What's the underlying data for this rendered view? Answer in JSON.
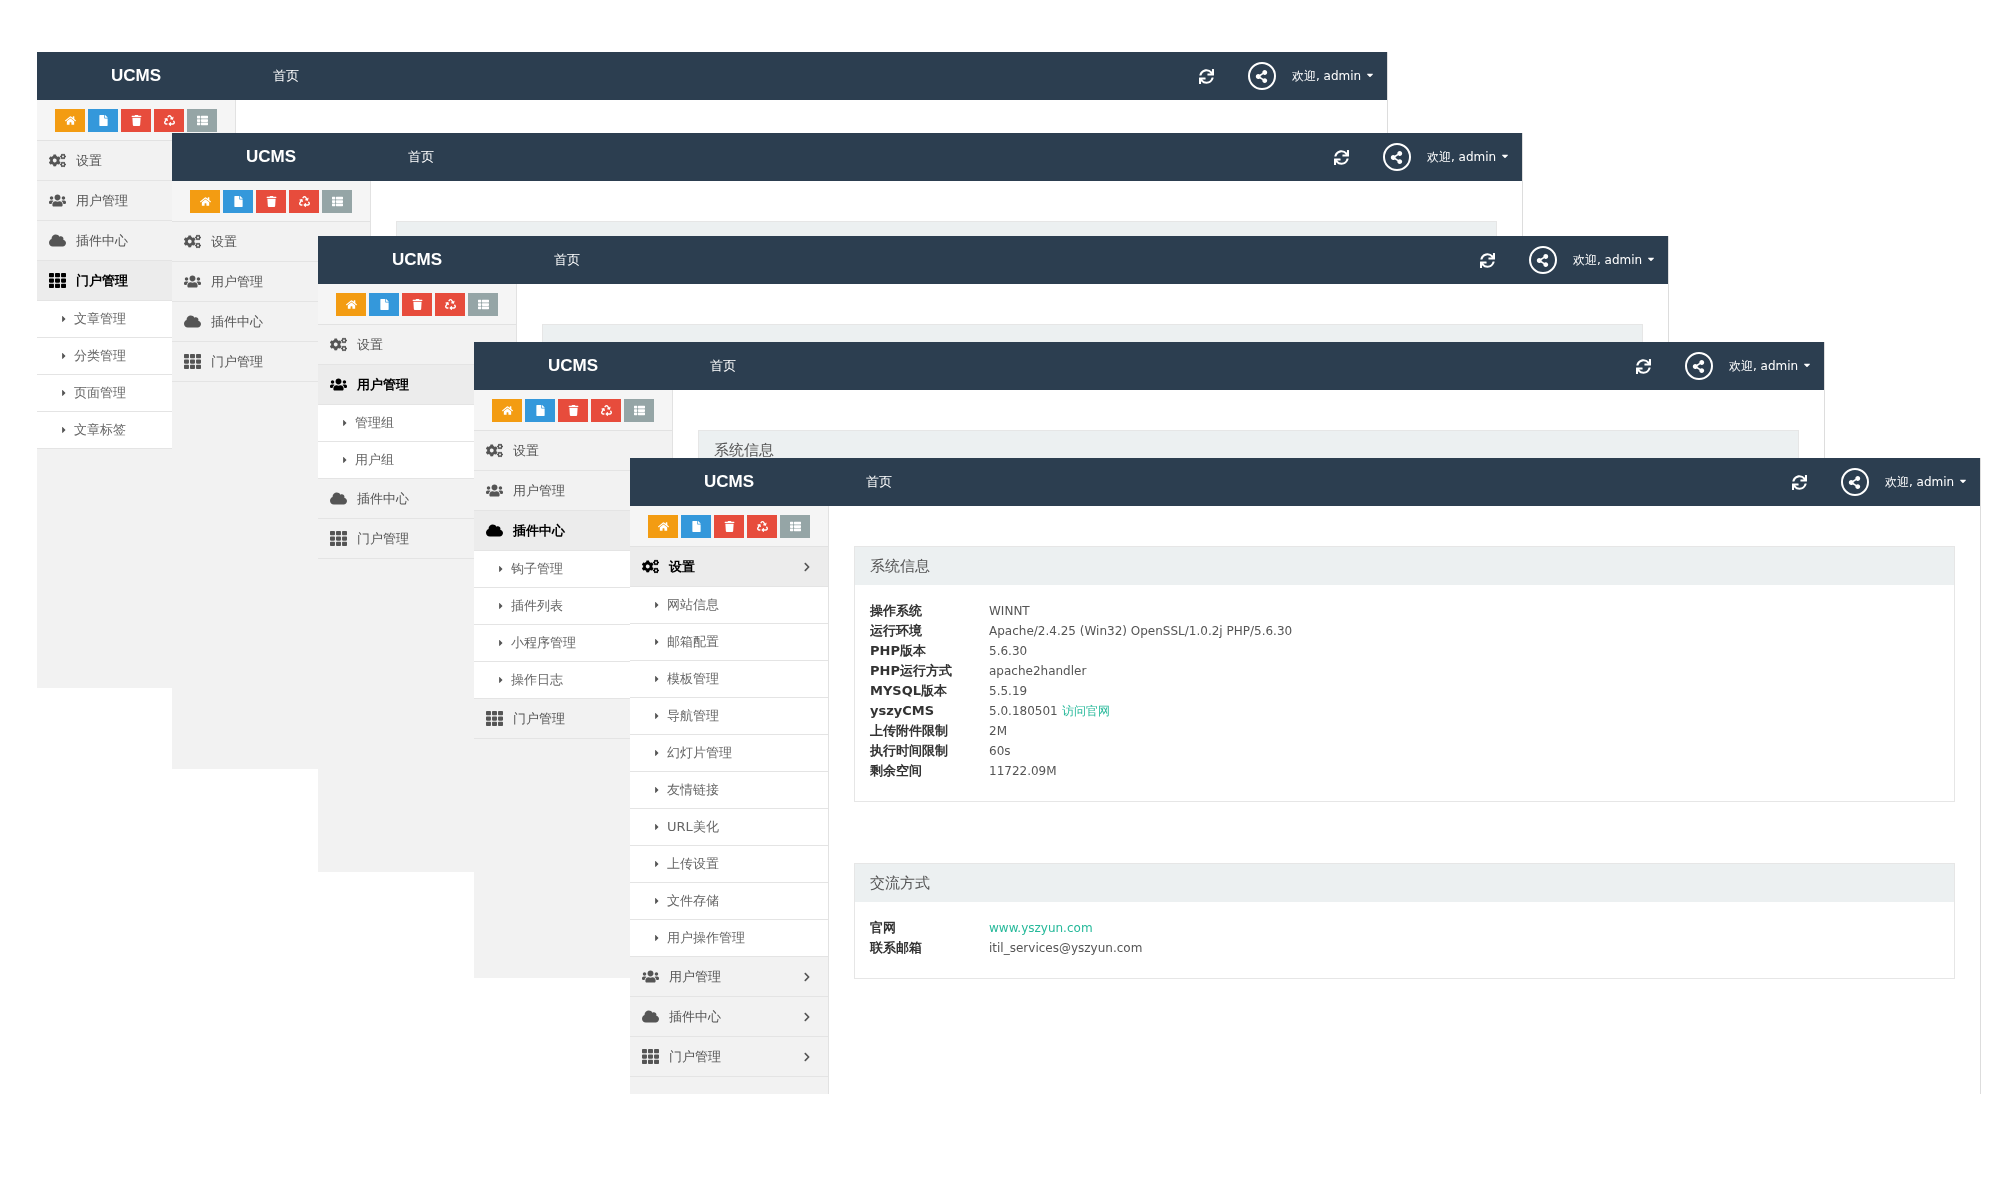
{
  "windows": [
    {
      "brand": "UCMS",
      "nav": "首页",
      "user": "欢迎, admin",
      "menu": [
        {
          "label": "设置",
          "selected": false
        },
        {
          "label": "用户管理",
          "selected": false
        },
        {
          "label": "插件中心",
          "selected": false
        },
        {
          "label": "门户管理",
          "selected": true,
          "children": [
            {
              "label": "文章管理"
            },
            {
              "label": "分类管理"
            },
            {
              "label": "页面管理"
            },
            {
              "label": "文章标签"
            }
          ]
        }
      ]
    },
    {
      "brand": "UCMS",
      "nav": "首页",
      "user": "欢迎, admin",
      "menu": [
        {
          "label": "设置",
          "selected": false
        },
        {
          "label": "用户管理",
          "selected": false
        },
        {
          "label": "插件中心",
          "selected": false
        },
        {
          "label": "门户管理",
          "selected": false
        }
      ],
      "panels": [
        {
          "kind": "strip"
        }
      ]
    },
    {
      "brand": "UCMS",
      "nav": "首页",
      "user": "欢迎, admin",
      "menu": [
        {
          "label": "设置",
          "selected": false
        },
        {
          "label": "用户管理",
          "selected": true,
          "children": [
            {
              "label": "管理组"
            },
            {
              "label": "用户组"
            }
          ]
        },
        {
          "label": "插件中心",
          "selected": false
        },
        {
          "label": "门户管理",
          "selected": false
        }
      ],
      "panels": [
        {
          "kind": "strip"
        }
      ]
    },
    {
      "brand": "UCMS",
      "nav": "首页",
      "user": "欢迎, admin",
      "menu": [
        {
          "label": "设置",
          "selected": false
        },
        {
          "label": "用户管理",
          "selected": false
        },
        {
          "label": "插件中心",
          "selected": true,
          "children": [
            {
              "label": "钩子管理"
            },
            {
              "label": "插件列表"
            },
            {
              "label": "小程序管理"
            },
            {
              "label": "操作日志"
            }
          ]
        },
        {
          "label": "门户管理",
          "selected": false
        }
      ],
      "panels": [
        {
          "kind": "strip",
          "title": "系统信息"
        }
      ]
    },
    {
      "brand": "UCMS",
      "nav": "首页",
      "user": "欢迎, admin",
      "menu": [
        {
          "label": "设置",
          "selected": true,
          "children": [
            {
              "label": "网站信息"
            },
            {
              "label": "邮箱配置"
            },
            {
              "label": "模板管理"
            },
            {
              "label": "导航管理"
            },
            {
              "label": "幻灯片管理"
            },
            {
              "label": "友情链接"
            },
            {
              "label": "URL美化"
            },
            {
              "label": "上传设置"
            },
            {
              "label": "文件存储"
            },
            {
              "label": "用户操作管理"
            }
          ]
        },
        {
          "label": "用户管理",
          "selected": false
        },
        {
          "label": "插件中心",
          "selected": false
        },
        {
          "label": "门户管理",
          "selected": false
        }
      ],
      "panels": [
        {
          "kind": "full",
          "title": "系统信息",
          "rows": [
            {
              "label": "操作系统",
              "value": "WINNT"
            },
            {
              "label": "运行环境",
              "value": "Apache/2.4.25 (Win32) OpenSSL/1.0.2j PHP/5.6.30"
            },
            {
              "label": "PHP版本",
              "value": "5.6.30"
            },
            {
              "label": "PHP运行方式",
              "value": "apache2handler"
            },
            {
              "label": "MYSQL版本",
              "value": "5.5.19"
            },
            {
              "label": "yszyCMS",
              "value": "5.0.180501",
              "link": "访问官网"
            },
            {
              "label": "上传附件限制",
              "value": "2M"
            },
            {
              "label": "执行时间限制",
              "value": "60s"
            },
            {
              "label": "剩余空间",
              "value": "11722.09M"
            }
          ]
        },
        {
          "kind": "full",
          "title": "交流方式",
          "rows": [
            {
              "label": "官网",
              "link": "www.yszyun.com"
            },
            {
              "label": "联系邮箱",
              "value": "itil_services@yszyun.com"
            }
          ]
        }
      ]
    }
  ]
}
